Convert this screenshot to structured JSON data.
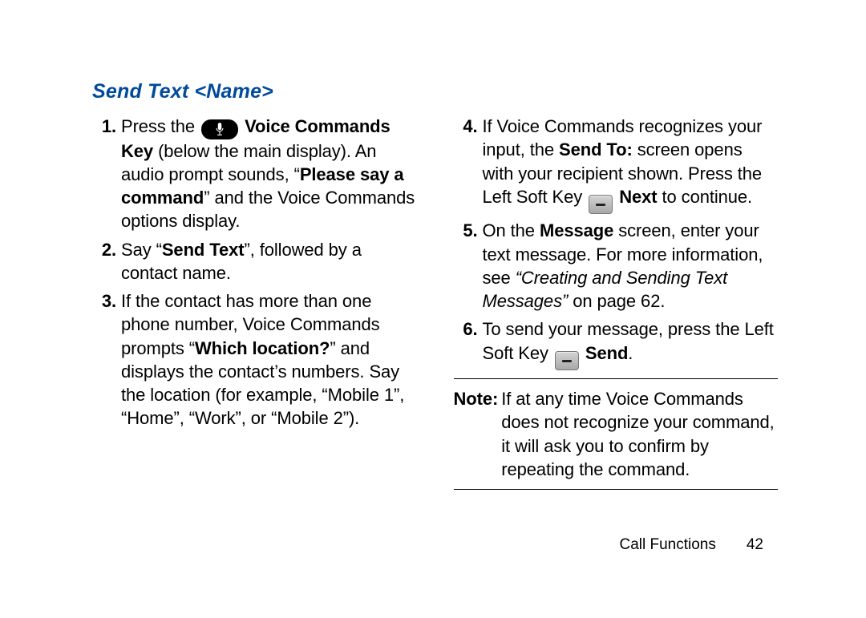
{
  "heading": "Send Text <Name>",
  "left_steps": [
    {
      "num": "1.",
      "parts": [
        {
          "t": "Press the "
        },
        {
          "icon": "mic"
        },
        {
          "t": " "
        },
        {
          "b": "Voice Commands Key"
        },
        {
          "t": " (below the main display). An audio prompt sounds, “"
        },
        {
          "b": "Please say a command"
        },
        {
          "t": "” and the Voice Commands options display."
        }
      ]
    },
    {
      "num": "2.",
      "parts": [
        {
          "t": "Say “"
        },
        {
          "b": "Send Text"
        },
        {
          "t": "”, followed by a contact name."
        }
      ]
    },
    {
      "num": "3.",
      "parts": [
        {
          "t": "If the contact has more than one phone number, Voice Commands prompts “"
        },
        {
          "b": "Which location?"
        },
        {
          "t": "” and displays the contact’s numbers. Say the location (for example, “Mobile 1”, “Home”, “Work”, or “Mobile 2”)."
        }
      ]
    }
  ],
  "right_steps": [
    {
      "num": "4.",
      "parts": [
        {
          "t": "If Voice Commands recognizes your input, the "
        },
        {
          "b": "Send To:"
        },
        {
          "t": " screen opens with your recipient shown. Press the Left Soft Key "
        },
        {
          "icon": "soft"
        },
        {
          "t": " "
        },
        {
          "b": "Next"
        },
        {
          "t": " to continue."
        }
      ]
    },
    {
      "num": "5.",
      "parts": [
        {
          "t": "On the "
        },
        {
          "b": "Message"
        },
        {
          "t": " screen, enter your text message. For more information, see "
        },
        {
          "i": "“Creating and Sending Text Messages”"
        },
        {
          "t": " on page 62."
        }
      ]
    },
    {
      "num": "6.",
      "parts": [
        {
          "t": "To send your message, press the Left Soft Key "
        },
        {
          "icon": "soft"
        },
        {
          "t": " "
        },
        {
          "b": "Send"
        },
        {
          "t": "."
        }
      ]
    }
  ],
  "note": {
    "label": "Note:",
    "body": "If at any time Voice Commands does not recognize your command, it will ask you to confirm by repeating the command."
  },
  "footer": {
    "section": "Call Functions",
    "page": "42"
  }
}
